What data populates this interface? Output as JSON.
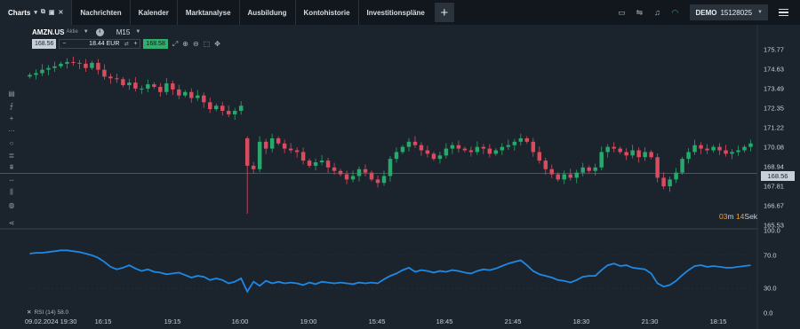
{
  "topbar": {
    "tabs": [
      {
        "label": "Charts",
        "active": true
      },
      {
        "label": "Nachrichten"
      },
      {
        "label": "Kalender"
      },
      {
        "label": "Marktanalyse"
      },
      {
        "label": "Ausbildung"
      },
      {
        "label": "Kontohistorie"
      },
      {
        "label": "Investitionspläne"
      }
    ],
    "account_mode": "DEMO",
    "account_number": "15128025",
    "icons": [
      "layout-icon",
      "connection-icon",
      "bell-icon",
      "wifi-icon",
      "menu-icon"
    ]
  },
  "instrument": {
    "symbol": "AMZN.US",
    "subtitle": "Aktie",
    "timeframe": "M15"
  },
  "trade": {
    "sell_price": "168.56",
    "amount": "18.44 EUR",
    "buy_price": "168.58"
  },
  "timer": {
    "minutes": "03",
    "m_unit": "m",
    "seconds": "14",
    "s_unit": "Sek"
  },
  "current_price_tag": "168.56",
  "rsi_legend": "RSI (14) 58.0",
  "cursor_date": "09.02.2024 19:30",
  "colors": {
    "up": "#26a96b",
    "down": "#d94b5e",
    "rsi": "#1e88e5",
    "background": "#1b242d"
  },
  "chart_data": [
    {
      "type": "candlestick",
      "symbol": "AMZN.US",
      "timeframe": "M15",
      "y_tick_labels": [
        "175.77",
        "174.63",
        "173.49",
        "172.35",
        "171.22",
        "170.08",
        "168.94",
        "167.81",
        "166.67",
        "165.53"
      ],
      "y_ticks": [
        175.77,
        174.63,
        173.49,
        172.35,
        171.22,
        170.08,
        168.94,
        167.81,
        166.67,
        165.53
      ],
      "ylim": [
        165.53,
        175.77
      ],
      "x_tick_labels": [
        "16:15",
        "19:15",
        "16:00",
        "19:00",
        "15:45",
        "18:45",
        "21:45",
        "18:30",
        "21:30",
        "18:15"
      ],
      "current_price": 168.56,
      "close": [
        174.3,
        174.4,
        174.6,
        174.7,
        174.8,
        174.95,
        175.05,
        175.0,
        174.95,
        174.7,
        175.0,
        174.6,
        174.2,
        174.1,
        174.05,
        173.7,
        173.85,
        173.5,
        173.5,
        173.75,
        173.6,
        173.3,
        173.8,
        173.45,
        173.1,
        173.3,
        172.95,
        173.1,
        172.7,
        172.3,
        172.5,
        172.2,
        172.0,
        172.2,
        172.5,
        169.0,
        168.8,
        170.4,
        170.0,
        170.6,
        170.3,
        170.0,
        169.9,
        169.8,
        169.3,
        169.0,
        169.2,
        169.3,
        168.9,
        168.7,
        168.5,
        168.2,
        168.4,
        168.8,
        168.6,
        168.2,
        168.0,
        168.4,
        169.4,
        169.8,
        170.1,
        170.4,
        170.2,
        169.9,
        169.7,
        169.4,
        169.6,
        170.0,
        170.2,
        170.0,
        169.9,
        169.8,
        170.1,
        170.0,
        169.7,
        169.9,
        170.1,
        170.2,
        170.4,
        170.6,
        170.4,
        169.8,
        169.3,
        168.8,
        168.5,
        168.2,
        168.5,
        168.3,
        168.6,
        168.9,
        168.7,
        168.9,
        169.8,
        170.1,
        170.0,
        169.8,
        169.6,
        169.9,
        169.5,
        169.8,
        169.5,
        168.3,
        167.8,
        168.2,
        168.6,
        169.4,
        169.8,
        170.2,
        170.0,
        169.9,
        170.1,
        169.9,
        169.7,
        169.8,
        169.9,
        170.1,
        170.3
      ],
      "rsi": {
        "name": "RSI (14)",
        "last": 58.0,
        "ylim": [
          0,
          100
        ],
        "y_tick_labels": [
          "100.0",
          "70.0",
          "30.0",
          "0.0"
        ],
        "levels": [
          70,
          30
        ],
        "values": [
          72,
          73,
          73,
          74,
          75,
          76,
          76,
          75,
          74,
          72,
          70,
          67,
          62,
          56,
          53,
          55,
          58,
          54,
          51,
          53,
          50,
          49,
          47,
          48,
          49,
          46,
          43,
          45,
          44,
          40,
          42,
          40,
          36,
          38,
          42,
          26,
          38,
          33,
          39,
          36,
          38,
          36,
          37,
          36,
          34,
          37,
          35,
          38,
          37,
          36,
          37,
          36,
          35,
          37,
          36,
          37,
          36,
          41,
          45,
          48,
          52,
          55,
          50,
          52,
          51,
          49,
          51,
          50,
          52,
          51,
          49,
          48,
          51,
          53,
          52,
          54,
          57,
          60,
          62,
          64,
          58,
          51,
          47,
          45,
          43,
          40,
          39,
          37,
          40,
          44,
          45,
          45,
          52,
          58,
          60,
          57,
          58,
          55,
          54,
          53,
          48,
          36,
          32,
          34,
          39,
          46,
          52,
          57,
          58,
          56,
          57,
          56,
          55,
          55,
          56,
          57,
          58
        ]
      }
    }
  ]
}
